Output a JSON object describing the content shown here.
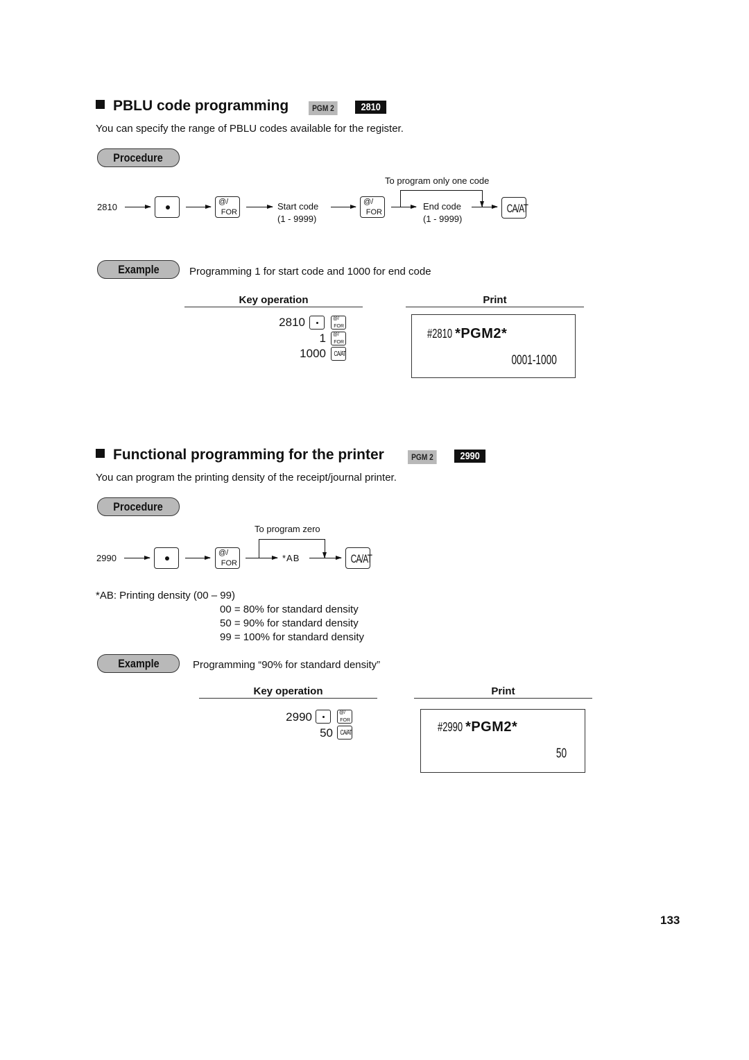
{
  "sections": [
    {
      "title": "PBLU code programming",
      "mode_badge": "PGM 2",
      "code_badge": "2810",
      "description": "You can specify the range of PBLU codes available for the register.",
      "procedure_label": "Procedure",
      "procedure": {
        "start_number": "2810",
        "bypass_label": "To program only one code",
        "step1_label": "Start code",
        "step1_range": "(1 - 9999)",
        "step2_label": "End code",
        "step2_range": "(1 - 9999)"
      },
      "example_label": "Example",
      "example_text": "Programming 1 for start code and 1000 for end code",
      "key_operation_header": "Key operation",
      "print_header": "Print",
      "key_operations": [
        {
          "number": "2810",
          "keys": [
            "dot",
            "for"
          ]
        },
        {
          "number": "1",
          "keys": [
            "for"
          ]
        },
        {
          "number": "1000",
          "keys": [
            "caat"
          ]
        }
      ],
      "print": {
        "line1_code": "#2810",
        "line1_mode": "*PGM2*",
        "line2_value": "0001-1000"
      }
    },
    {
      "title": "Functional programming for the printer",
      "mode_badge": "PGM 2",
      "code_badge": "2990",
      "description": "You can program the printing density of the receipt/journal printer.",
      "procedure_label": "Procedure",
      "procedure": {
        "start_number": "2990",
        "bypass_label": "To program zero",
        "step1_label": "*AB"
      },
      "notes": {
        "heading": "*AB:  Printing density (00 – 99)",
        "items": [
          "00 =   80% for standard density",
          "50 =   90% for standard density",
          "99 = 100% for standard density"
        ]
      },
      "example_label": "Example",
      "example_text": "Programming “90% for standard density”",
      "key_operation_header": "Key operation",
      "print_header": "Print",
      "key_operations": [
        {
          "number": "2990",
          "keys": [
            "dot",
            "for"
          ]
        },
        {
          "number": "50",
          "keys": [
            "caat"
          ]
        }
      ],
      "print": {
        "line1_code": "#2990",
        "line1_mode": "*PGM2*",
        "line2_value": "50"
      }
    }
  ],
  "keys": {
    "for_top": "@/",
    "for_bottom": "FOR",
    "caat": "CA/AT"
  },
  "page_number": "133"
}
